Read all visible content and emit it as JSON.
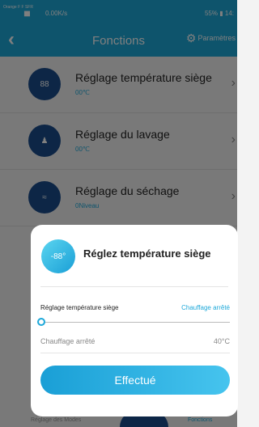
{
  "status_bar": {
    "carrier": "Orange F\nF SFR",
    "network": "0.00K/s",
    "battery": "55%",
    "time": "14:"
  },
  "header": {
    "back_icon": "chevron-left-icon",
    "title": "Fonctions",
    "params_label": "Paramètres",
    "params_icon": "gear-icon"
  },
  "list": {
    "items": [
      {
        "title": "Réglage température siège",
        "sub": "00℃",
        "icon": "88"
      },
      {
        "title": "Réglage du lavage",
        "sub": "00℃",
        "icon": "washing-person-icon"
      },
      {
        "title": "Réglage du séchage",
        "sub": "0Niveau",
        "icon": "drying-icon"
      }
    ]
  },
  "bottom_nav": {
    "left_label": "Réglage des Modes",
    "right_label": "Fonctions"
  },
  "dialog": {
    "icon_text": "-88°",
    "title": "Réglez température siège",
    "setting_label": "Réglage température siège",
    "setting_state": "Chauffage arrêté",
    "slider_value": 0,
    "min_label": "Chauffage arrêté",
    "max_label": "40°C",
    "confirm_label": "Effectué"
  },
  "colors": {
    "primary": "#1da8d9",
    "icon_bg": "#1a4d8c"
  }
}
